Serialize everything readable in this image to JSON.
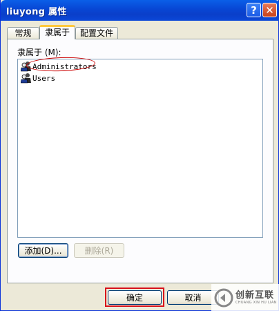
{
  "window": {
    "title": "liuyong 属性",
    "help_glyph": "?",
    "close_glyph": "✕"
  },
  "tabs": [
    {
      "label": "常规"
    },
    {
      "label": "隶属于",
      "active": true
    },
    {
      "label": "配置文件"
    }
  ],
  "panel": {
    "list_label": "隶属于 (M):",
    "items": [
      {
        "name": "Administrators",
        "icon": "group-icon"
      },
      {
        "name": "Users",
        "icon": "group-icon"
      }
    ],
    "add_button": "添加(D)...",
    "remove_button": "删除(R)"
  },
  "footer": {
    "ok_button": "确定",
    "cancel_button": "取消"
  },
  "watermark": {
    "main": "创新互联",
    "sub": "CHUANG XIN HU LIAN"
  },
  "colors": {
    "titlebar": "#0a4fd8",
    "highlight": "#d8101a"
  }
}
